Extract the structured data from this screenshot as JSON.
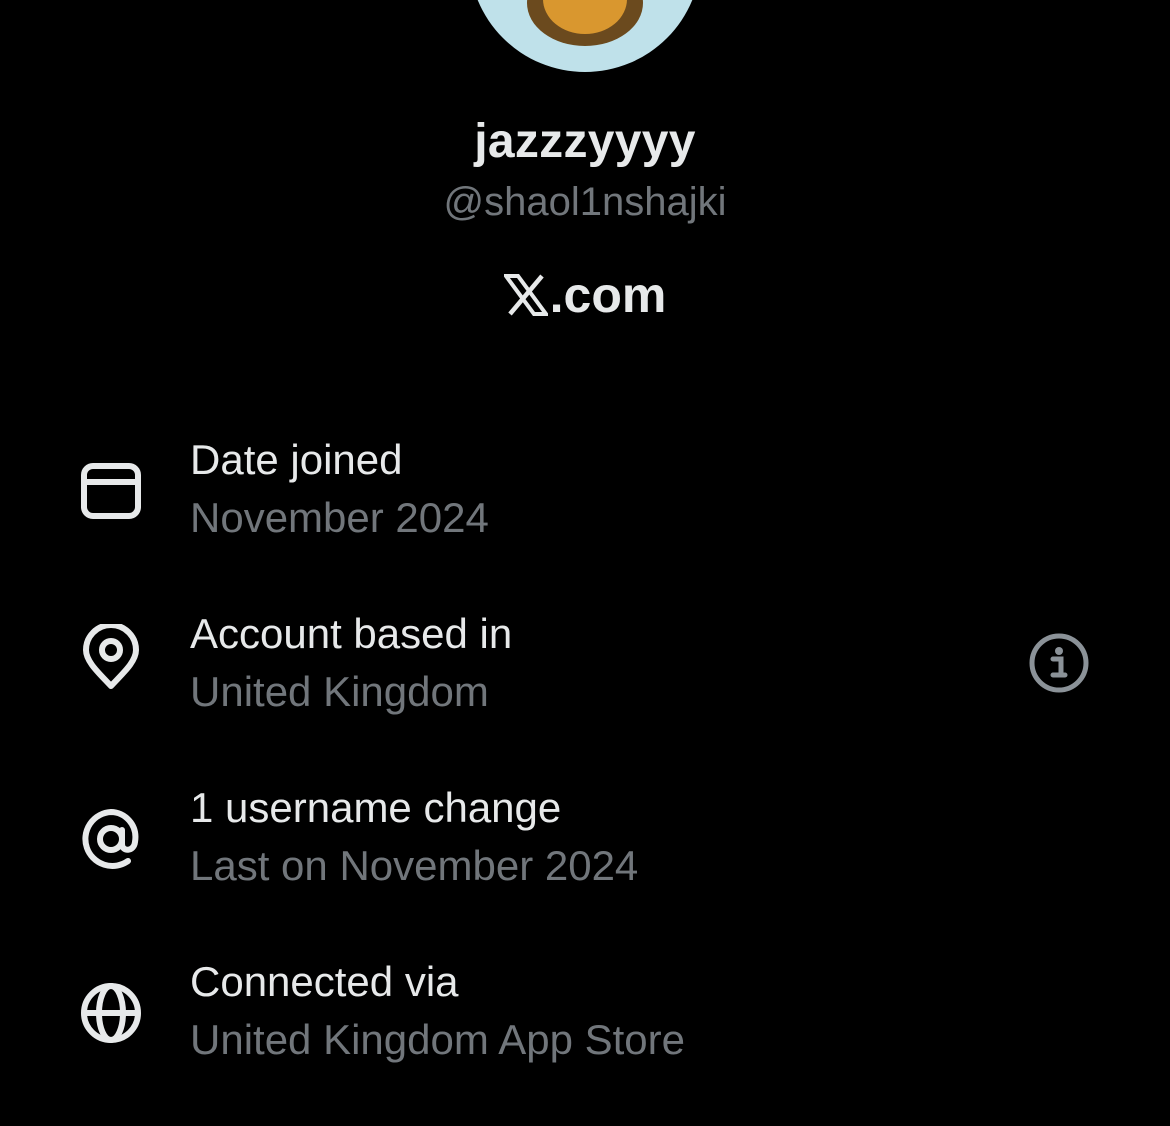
{
  "profile": {
    "display_name": "jazzzyyyy",
    "handle": "@shaol1nshajki",
    "brand_suffix": ".com"
  },
  "about": {
    "rows": [
      {
        "icon": "calendar-icon",
        "label": "Date joined",
        "value": "November 2024"
      },
      {
        "icon": "location-pin-icon",
        "label": "Account based in",
        "value": "United Kingdom"
      },
      {
        "icon": "at-sign-icon",
        "label": "1 username change",
        "value": "Last on November 2024"
      },
      {
        "icon": "globe-icon",
        "label": "Connected via",
        "value": "United Kingdom App Store"
      }
    ]
  },
  "colors": {
    "background": "#000000",
    "primary_text": "#e7e9ea",
    "secondary_text": "#71767b",
    "avatar_bg": "#bfe1ea"
  }
}
